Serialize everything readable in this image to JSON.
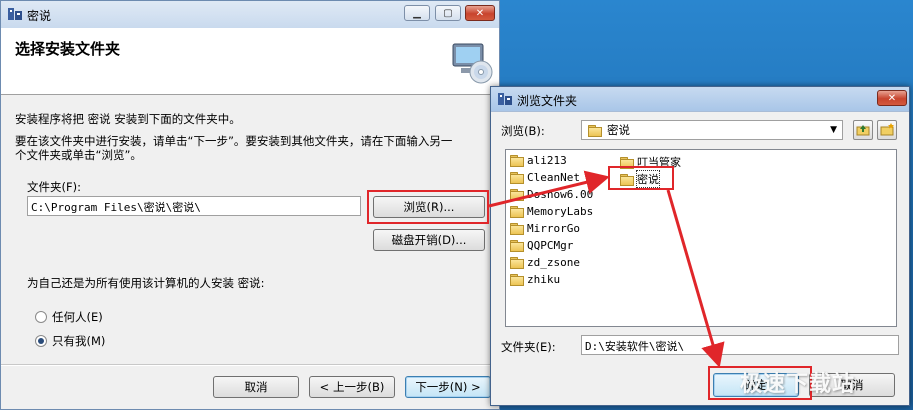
{
  "installer": {
    "title": "密说",
    "header_title": "选择安装文件夹",
    "intro": "安装程序将把 密说 安装到下面的文件夹中。",
    "instruction_line1": "要在该文件夹中进行安装，请单击“下一步”。要安装到其他文件夹，请在下面输入另一",
    "instruction_line2": "个文件夹或单击“浏览”。",
    "folder_label": "文件夹(F):",
    "folder_value": "C:\\Program Files\\密说\\密说\\",
    "browse_button": "浏览(R)...",
    "disk_cost_button": "磁盘开销(D)...",
    "install_for_question": "为自己还是为所有使用该计算机的人安装 密说:",
    "radio_everyone": "任何人(E)",
    "radio_just_me": "只有我(M)",
    "radio_selected": "just_me",
    "cancel_button": "取消",
    "back_button": "< 上一步(B)",
    "next_button": "下一步(N) >"
  },
  "browse_dialog": {
    "title": "浏览文件夹",
    "look_in_label": "浏览(B):",
    "look_in_value": "密说",
    "folders_col1": [
      "ali213",
      "CleanNet",
      "Doshow6.00",
      "MemoryLabs",
      "MirrorGo",
      "QQPCMgr",
      "zd_zsone",
      "zhiku"
    ],
    "folders_col2": [
      "叮当管家",
      "密说"
    ],
    "selected_folder": "密说",
    "folder_label": "文件夹(E):",
    "folder_value": "D:\\安装软件\\密说\\",
    "ok_button": "确定",
    "cancel_button": "取消"
  },
  "watermark": "极速下载站",
  "colors": {
    "annotation_red": "#e0262a",
    "desktop_blue": "#1f6fb4",
    "dialog_bg": "#f0f0f0"
  },
  "icons": [
    "app-icon",
    "minimize-icon",
    "maximize-icon",
    "close-icon",
    "cd-setup-icon",
    "folder-icon",
    "up-folder-icon",
    "new-folder-icon",
    "dropdown-arrow-icon"
  ]
}
